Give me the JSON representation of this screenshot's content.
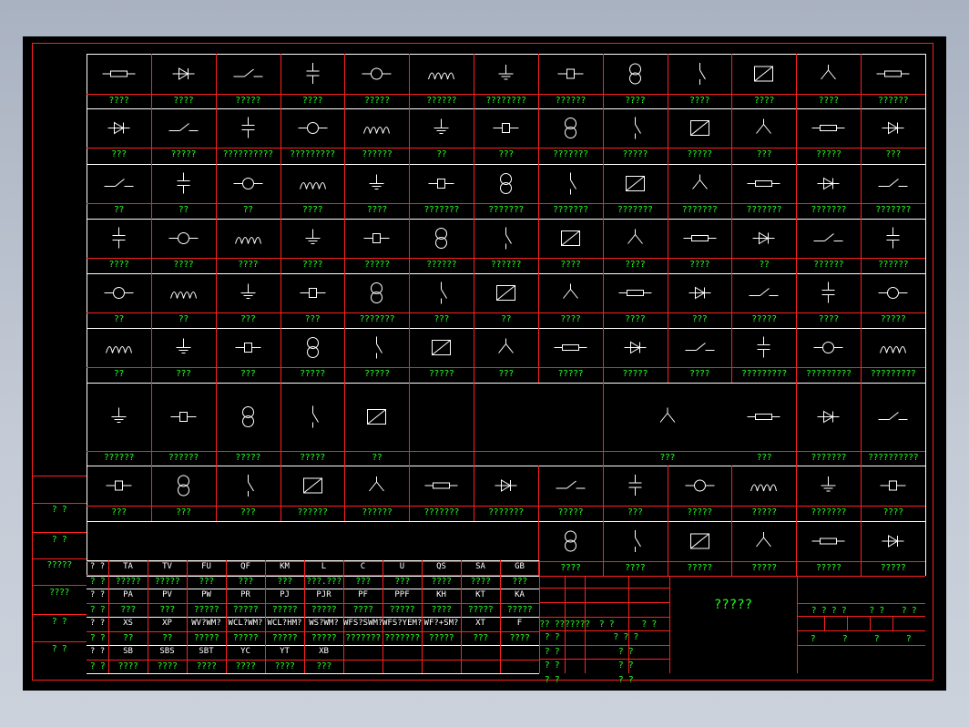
{
  "colors": {
    "background": "#000000",
    "border": "#ff2020",
    "label": "#22ff22",
    "symbol": "#ffffff"
  },
  "grid": {
    "rows": [
      {
        "labels": [
          "????",
          "????",
          "?????",
          "????",
          "?????",
          "??????",
          "????????",
          "??????",
          "????",
          "????",
          "????",
          "????",
          "??????"
        ],
        "icons": [
          "resistor-icon",
          "variable-resistor-icon",
          "potentiometer-icon",
          "heater-element-icon",
          "capacitor-icon",
          "polarized-capacitor-icon",
          "inductor-icon",
          "iron-core-inductor-icon",
          "lamp-socket-icon",
          "indicator-lamp-icon",
          "earth-ground-icon",
          "protective-earth-icon",
          "chassis-ground-icon"
        ]
      },
      {
        "labels": [
          "???",
          "?????",
          "??????????",
          "?????????",
          "??????",
          "??",
          "???",
          "???????",
          "?????",
          "?????",
          "???",
          "?????",
          "???"
        ],
        "icons": [
          "diode-icon",
          "led-icon",
          "bell-icon",
          "buzzer-icon",
          "transformer-icon",
          "battery-cell-icon",
          "battery-icon",
          "current-transformer-icon",
          "voltage-transformer-icon",
          "isolation-transformer-icon",
          "rectifier-icon",
          "bridge-rectifier-icon",
          "inverter-icon"
        ]
      },
      {
        "labels": [
          "??",
          "??",
          "??",
          "????",
          "????",
          "???????",
          "???????",
          "???????",
          "???????",
          "???????",
          "???????",
          "???????",
          "???????"
        ],
        "icons": [
          "no-contact-icon",
          "nc-contact-icon",
          "changeover-contact-icon",
          "make-before-break-icon",
          "pushbutton-contact-icon",
          "time-delay-on-icon",
          "time-delay-off-icon",
          "time-delay-nc-icon",
          "limit-switch-no-icon",
          "limit-switch-nc-icon",
          "pressure-switch-icon",
          "float-switch-icon",
          "temperature-switch-icon"
        ]
      },
      {
        "labels": [
          "????",
          "????",
          "????",
          "????",
          "?????",
          "??????",
          "??????",
          "????",
          "????",
          "????",
          "??",
          "??????",
          "??????"
        ],
        "icons": [
          "thermal-relay-contact-icon",
          "thermal-relay-nc-icon",
          "fuse-switch-icon",
          "emergency-stop-icon",
          "selector-switch-icon",
          "contactor-no-icon",
          "contactor-nc-icon",
          "breaker-contact-icon",
          "relay-coil-green-icon",
          "relay-coil-icon",
          "coil-icon",
          "coil-red-icon",
          "coil-red-2-icon"
        ]
      },
      {
        "labels": [
          "??",
          "??",
          "???",
          "???",
          "???????",
          "???",
          "??",
          "????",
          "????",
          "???",
          "?????",
          "????",
          "?????"
        ],
        "icons": [
          "solenoid-icon",
          "brake-coil-icon",
          "valve-icon",
          "fuse-icon",
          "fuse-disconnector-icon",
          "terminal-block-icon",
          "knob-icon",
          "plug-icon",
          "socket-icon",
          "lamp-cross-icon",
          "heater-coil-icon",
          "thermistor-icon",
          "overload-trip-icon"
        ]
      },
      {
        "labels": [
          "??",
          "???",
          "???",
          "?????",
          "?????",
          "?????",
          "???",
          "?????",
          "?????",
          "????",
          "?????????",
          "?????????",
          "?????????"
        ],
        "icons": [
          "meter-icon",
          "ammeter-icon",
          "voltmeter-icon",
          "wattmeter-icon",
          "varmeter-icon",
          "energy-meter-icon",
          "frequency-meter-icon",
          "counter-icon",
          "hour-meter-icon",
          "antenna-icon",
          "antenna-2-icon",
          "antenna-3-icon",
          "antenna-4-icon"
        ]
      },
      {
        "labels": [
          "??????",
          "??????",
          "?????",
          "?????",
          "??",
          "???",
          "???",
          "???????",
          "??????????"
        ],
        "icons": [
          "plug-socket-icon",
          "switch-key-icon",
          "switch-key-2-icon",
          "switch-key-3-icon",
          "motor-3phase-icon",
          "bridge-circuit-icon",
          "bridge-circuit-2-icon",
          "two-winding-transformer-icon",
          "three-winding-transformer-icon"
        ]
      },
      {
        "labels": [
          "???",
          "???",
          "???",
          "??????",
          "??????",
          "???????",
          "???????",
          "?????",
          "???",
          "?????",
          "?????",
          "???????",
          "????"
        ],
        "icons": [
          "fuse-vertical-icon",
          "fuse-resistor-icon",
          "thermal-overload-icon",
          "phase-protector-icon",
          "disconnector-icon",
          "load-switch-icon",
          "three-pole-switch-icon",
          "motor-starter-icon",
          "breaker-switch-icon",
          "breaker-2pole-icon",
          "isolator-icon",
          "breaker-trip-icon",
          "relay-box-icon"
        ]
      },
      {
        "labels": [
          "????",
          "????",
          "?????",
          "?????",
          "?????",
          "?????"
        ],
        "icons": [
          "arrow-up-icon",
          "arrow-down-icon",
          "lightning-arrester-icon",
          "surge-arrester-icon",
          "motor-m-icon",
          "generator-g-icon"
        ]
      }
    ]
  },
  "legend": {
    "left_labels": [
      "?  ?",
      "?  ?",
      "?????",
      "????",
      "?  ?",
      "?  ?"
    ],
    "rows": [
      {
        "head": "?  ?",
        "cells": [
          "TA",
          "TV",
          "FU",
          "QF",
          "KM",
          "L",
          "C",
          "U",
          "QS",
          "SA",
          "GB"
        ]
      },
      {
        "head": "?  ?",
        "cells": [
          "?????",
          "?????",
          "???",
          "???",
          "???",
          "???.???",
          "???",
          "???",
          "????",
          "????",
          "???"
        ]
      },
      {
        "head": "?  ?",
        "cells": [
          "PA",
          "PV",
          "PW",
          "PR",
          "PJ",
          "PJR",
          "PF",
          "PPF",
          "KH",
          "KT",
          "KA"
        ]
      },
      {
        "head": "?  ?",
        "cells": [
          "???",
          "???",
          "?????",
          "?????",
          "?????",
          "?????",
          "????",
          "?????",
          "????",
          "?????",
          "?????"
        ]
      },
      {
        "head": "?  ?",
        "cells": [
          "XS",
          "XP",
          "WV?WM?",
          "WCL?WM?",
          "WCL?HM?",
          "WS?WM?",
          "WFS?SWM?",
          "WFS?YEM?",
          "WF?+SM?",
          "XT",
          "F"
        ]
      },
      {
        "head": "?  ?",
        "cells": [
          "??",
          "??",
          "?????",
          "?????",
          "?????",
          "?????",
          "???????",
          "???????",
          "?????",
          "???",
          "????"
        ]
      },
      {
        "head": "?  ?",
        "cells": [
          "SB",
          "SBS",
          "SBT",
          "YC",
          "YT",
          "XB",
          "",
          "",
          "",
          "",
          ""
        ]
      },
      {
        "head": "?  ?",
        "cells": [
          "????",
          "????",
          "????",
          "????",
          "????",
          "???",
          "",
          "",
          "",
          "",
          ""
        ]
      }
    ]
  },
  "title_block": {
    "title": "?????",
    "rev_row": [
      "?? ??",
      "?????",
      "?  ?",
      "?  ?"
    ],
    "mid_labels": [
      "?  ?",
      "?  ?",
      "?  ?",
      "?  ?"
    ],
    "mid_right": [
      "? ? ?",
      "?  ?",
      "?  ?",
      "?  ?"
    ],
    "right_top": [
      "? ? ? ?",
      "?  ?",
      "?  ?"
    ],
    "right_bottom": [
      "?",
      "?",
      "?",
      "?"
    ]
  }
}
